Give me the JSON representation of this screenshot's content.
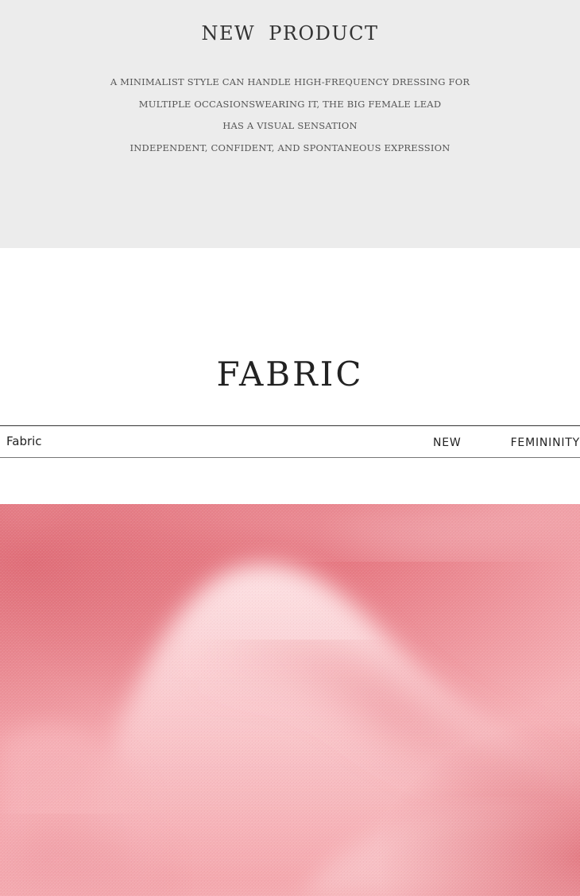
{
  "intro": {
    "title": "NEW  PRODUCT",
    "lines": [
      "A MINIMALIST STYLE CAN HANDLE HIGH-FREQUENCY DRESSING FOR",
      "MULTIPLE OCCASIONSWEARING IT, THE BIG FEMALE LEAD",
      "HAS A VISUAL SENSATION",
      "INDEPENDENT, CONFIDENT, AND SPONTANEOUS EXPRESSION"
    ]
  },
  "fabric_section": {
    "title": "FABRIC",
    "strip": {
      "left_label": "Fabric",
      "new_label": "NEW",
      "femininity_label": "FEMININITY"
    }
  },
  "photo": {
    "subject": "pink linen fabric folds",
    "colors": {
      "base": "#f2a3a8",
      "highlight": "#fbd9dc",
      "shadow": "#de6f78"
    }
  }
}
